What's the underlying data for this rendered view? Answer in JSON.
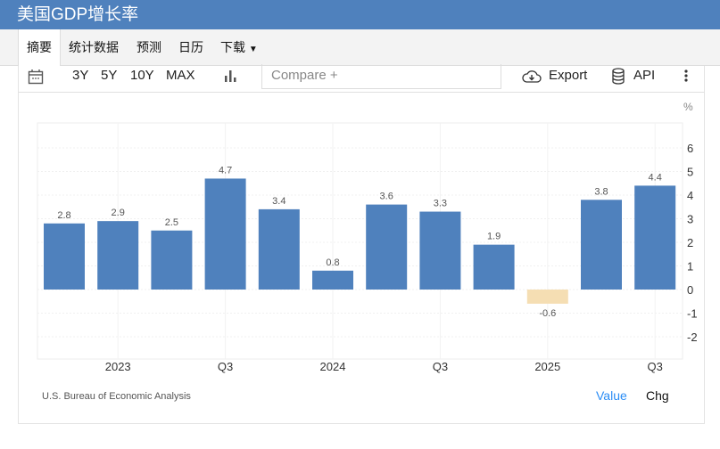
{
  "title": "美国GDP增长率",
  "tabs": [
    "摘要",
    "统计数据",
    "预测",
    "日历",
    "下载"
  ],
  "toolbar": {
    "ranges": [
      "3Y",
      "5Y",
      "10Y",
      "MAX"
    ],
    "compare": "Compare +",
    "export": "Export",
    "api": "API"
  },
  "unit": "%",
  "source": "U.S. Bureau of Economic Analysis",
  "toggle": {
    "value": "Value",
    "chg": "Chg"
  },
  "colors": {
    "positive": "#4f81bd",
    "negative": "#f5deb3",
    "header": "#4f81bd"
  },
  "chart_data": {
    "type": "bar",
    "categories": [
      "2022 Q4",
      "2023 Q1",
      "2023 Q2",
      "2023 Q3",
      "2023 Q4",
      "2024 Q1",
      "2024 Q2",
      "2024 Q3",
      "2024 Q4",
      "2025 Q1",
      "2025 Q2",
      "2025 Q3"
    ],
    "values": [
      2.8,
      2.9,
      2.5,
      4.7,
      3.4,
      0.8,
      3.6,
      3.3,
      1.9,
      -0.6,
      3.8,
      4.4
    ],
    "x_tick_labels": [
      {
        "index": 1,
        "label": "2023"
      },
      {
        "index": 3,
        "label": "Q3"
      },
      {
        "index": 5,
        "label": "2024"
      },
      {
        "index": 7,
        "label": "Q3"
      },
      {
        "index": 9,
        "label": "2025"
      },
      {
        "index": 11,
        "label": "Q3"
      }
    ],
    "y_ticks": [
      6,
      5,
      4,
      3,
      2,
      1,
      0,
      -1,
      -2
    ],
    "ylim": [
      -3,
      7
    ],
    "ylabel": "%",
    "grid": true
  }
}
